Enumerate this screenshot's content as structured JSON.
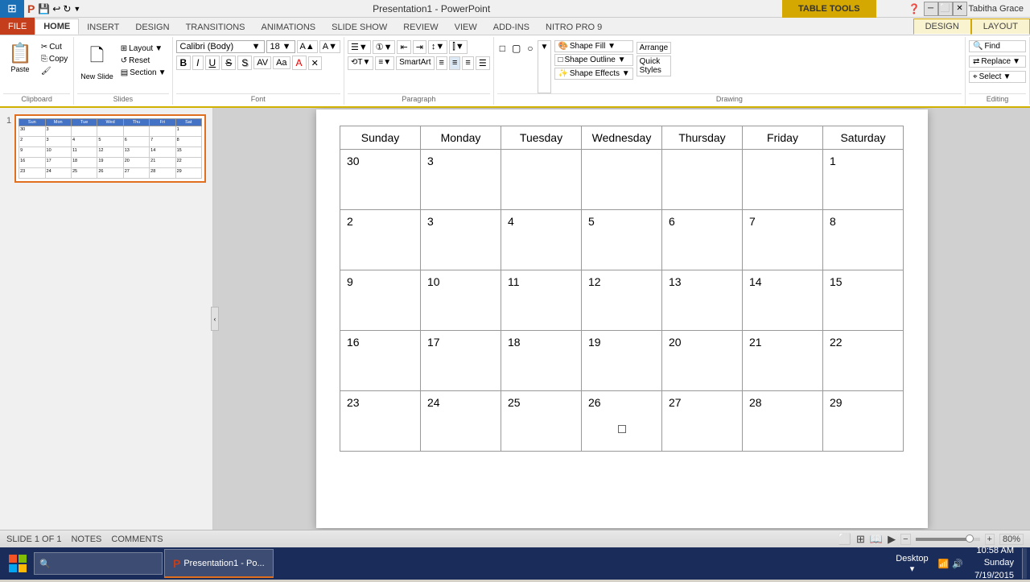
{
  "app": {
    "title": "Presentation1 - PowerPoint",
    "table_tools_label": "TABLE TOOLS",
    "user": "Tabitha Grace"
  },
  "tabs": {
    "main": [
      "FILE",
      "HOME",
      "INSERT",
      "DESIGN",
      "TRANSITIONS",
      "ANIMATIONS",
      "SLIDE SHOW",
      "REVIEW",
      "VIEW",
      "ADD-INS",
      "NITRO PRO 9"
    ],
    "active": "HOME",
    "table_tabs": [
      "DESIGN",
      "LAYOUT"
    ]
  },
  "ribbon": {
    "clipboard_label": "Clipboard",
    "slides_label": "Slides",
    "font_label": "Font",
    "paragraph_label": "Paragraph",
    "drawing_label": "Drawing",
    "editing_label": "Editing",
    "paste_label": "Paste",
    "new_slide_label": "New\nSlide",
    "layout_label": "Layout",
    "reset_label": "Reset",
    "section_label": "Section",
    "font_name": "Calibri (Body)",
    "font_size": "18",
    "find_label": "Find",
    "replace_label": "Replace",
    "select_label": "Select"
  },
  "calendar": {
    "headers": [
      "Sunday",
      "Monday",
      "Tuesday",
      "Wednesday",
      "Thursday",
      "Friday",
      "Saturday"
    ],
    "rows": [
      [
        "30",
        "3",
        "",
        "",
        "",
        "",
        "1"
      ],
      [
        "2",
        "3",
        "4",
        "5",
        "6",
        "7",
        "8"
      ],
      [
        "9",
        "10",
        "11",
        "12",
        "13",
        "14",
        "15"
      ],
      [
        "16",
        "17",
        "18",
        "19",
        "20",
        "21",
        "22"
      ],
      [
        "23",
        "24",
        "25",
        "26",
        "27",
        "28",
        "29"
      ]
    ]
  },
  "status_bar": {
    "slide_info": "SLIDE 1 OF 1",
    "notes_label": "NOTES",
    "comments_label": "COMMENTS",
    "zoom_level": "80%"
  },
  "taskbar": {
    "time": "10:58 AM",
    "date_line1": "Sunday",
    "date_line2": "7/19/2015",
    "desktop_label": "Desktop"
  }
}
